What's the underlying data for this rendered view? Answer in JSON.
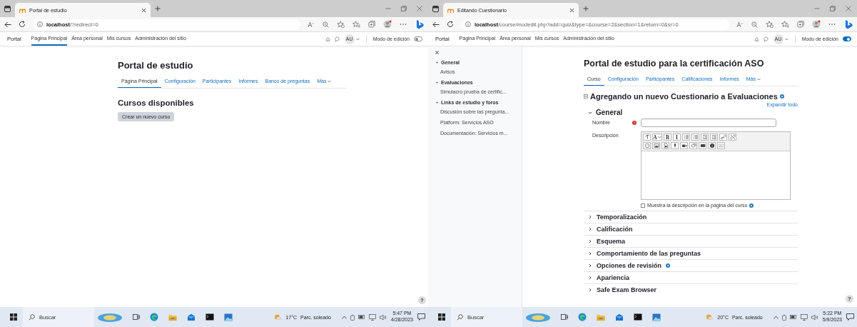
{
  "windows": [
    {
      "kind": "front_page",
      "browser": {
        "tab_title": "Portal de estudio",
        "url_host": "localhost",
        "url_path": "/?redirect=0"
      },
      "nav": {
        "brand": "Portal",
        "links": [
          {
            "label": "Página Principal",
            "selected": true
          },
          {
            "label": "Área personal",
            "selected": false
          },
          {
            "label": "Mis cursos",
            "selected": false
          },
          {
            "label": "Administración del sitio",
            "selected": false
          }
        ],
        "user_initials": "AU",
        "edit_mode_label": "Modo de edición",
        "edit_mode_on": false
      },
      "page": {
        "title": "Portal de estudio",
        "tabs": [
          {
            "label": "Página Principal",
            "selected": true,
            "menu": false
          },
          {
            "label": "Configuración",
            "selected": false,
            "menu": false
          },
          {
            "label": "Participantes",
            "selected": false,
            "menu": false
          },
          {
            "label": "Informes",
            "selected": false,
            "menu": false
          },
          {
            "label": "Banco de preguntas",
            "selected": false,
            "menu": false
          },
          {
            "label": "Más",
            "selected": false,
            "menu": true
          }
        ],
        "heading": "Cursos disponibles",
        "button": "Crear un nuevo curso",
        "help_button": "?"
      },
      "taskbar": {
        "search_placeholder": "Buscar",
        "temperature": "17°C",
        "weather": "Parc. soleado",
        "time": "5:47 PM",
        "date": "4/28/2023"
      }
    },
    {
      "kind": "quiz_form",
      "browser": {
        "tab_title": "Editando Cuestionario",
        "url_host": "localhost",
        "url_path": "/course/modedit.php?add=quiz&type=&course=2&section=1&return=0&sr=0"
      },
      "nav": {
        "brand": "Portal",
        "links": [
          {
            "label": "Página Principal",
            "selected": false
          },
          {
            "label": "Área personal",
            "selected": false
          },
          {
            "label": "Mis cursos",
            "selected": false
          },
          {
            "label": "Administración del sitio",
            "selected": false
          }
        ],
        "user_initials": "AU",
        "edit_mode_label": "Modo de edición",
        "edit_mode_on": true
      },
      "sidebar": {
        "sections": [
          {
            "title": "General",
            "expanded": true,
            "items": [
              "Avisos"
            ]
          },
          {
            "title": "Evaluaciones",
            "expanded": true,
            "items": [
              "Simulacro prueba de certific..."
            ]
          },
          {
            "title": "Links de estudio y foros",
            "expanded": true,
            "items": [
              "Discusión sobre las pregunta...",
              "Platform: Servicios ASO",
              "Documentación: Servicios m..."
            ]
          }
        ]
      },
      "page": {
        "title": "Portal de estudio para la certificación ASO",
        "tabs": [
          {
            "label": "Curso",
            "selected": true,
            "menu": false
          },
          {
            "label": "Configuración",
            "selected": false,
            "menu": false
          },
          {
            "label": "Participantes",
            "selected": false,
            "menu": false
          },
          {
            "label": "Calificaciones",
            "selected": false,
            "menu": false
          },
          {
            "label": "Informes",
            "selected": false,
            "menu": false
          },
          {
            "label": "Más",
            "selected": false,
            "menu": true
          }
        ],
        "heading": "Agregando un nuevo Cuestionario a Evaluaciones",
        "expand_all": "Expandir todo",
        "general": {
          "title": "General",
          "expanded": true,
          "name_label": "Nombre",
          "name_required": true,
          "description_label": "Descripción",
          "editor_toolbar": [
            [
              {
                "kind": "icon"
              },
              {
                "kind": "text",
                "label": "A"
              },
              {
                "kind": "text",
                "label": "B"
              },
              {
                "kind": "text",
                "label": "I"
              },
              {
                "kind": "icon"
              },
              {
                "kind": "icon"
              },
              {
                "kind": "icon"
              },
              {
                "kind": "icon"
              },
              {
                "kind": "icon"
              },
              {
                "kind": "icon"
              }
            ],
            [
              {
                "kind": "icon"
              },
              {
                "kind": "icon"
              },
              {
                "kind": "icon"
              },
              {
                "kind": "icon"
              },
              {
                "kind": "icon"
              },
              {
                "kind": "icon"
              },
              {
                "kind": "icon"
              },
              {
                "kind": "icon"
              },
              {
                "kind": "icon"
              }
            ]
          ],
          "show_description": {
            "label": "Muestra la descripción en la página del curso",
            "checked": false
          }
        },
        "sections": [
          {
            "title": "Temporalización",
            "expanded": false,
            "help": false
          },
          {
            "title": "Calificación",
            "expanded": false,
            "help": false
          },
          {
            "title": "Esquema",
            "expanded": false,
            "help": false
          },
          {
            "title": "Comportamiento de las preguntas",
            "expanded": false,
            "help": false
          },
          {
            "title": "Opciones de revisión",
            "expanded": false,
            "help": true
          },
          {
            "title": "Apariencia",
            "expanded": false,
            "help": false
          },
          {
            "title": "Safe Exam Browser",
            "expanded": false,
            "help": false
          }
        ],
        "help_button": "?"
      },
      "taskbar": {
        "search_placeholder": "Buscar",
        "temperature": "20°C",
        "weather": "Parc. soleado",
        "time": "5:22 PM",
        "date": "5/9/2023"
      }
    }
  ]
}
